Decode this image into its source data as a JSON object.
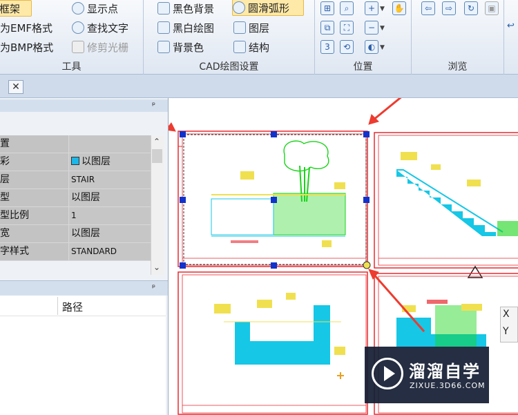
{
  "ribbon": {
    "tools_group": {
      "label": "工具",
      "items": [
        "框架",
        "为EMF格式",
        "为BMP格式",
        "显示点",
        "查找文字",
        "修剪光栅"
      ]
    },
    "cad_settings_group": {
      "label": "CAD绘图设置",
      "items": [
        "黑色背景",
        "黑白绘图",
        "背景色",
        "圆滑弧形",
        "图层",
        "结构"
      ]
    },
    "position_group": {
      "label": "位置"
    },
    "browse_group": {
      "label": "浏览"
    }
  },
  "tab_close_glyph": "✕",
  "properties_panel": {
    "pin_glyph": "ᵖ",
    "rows": [
      {
        "name": "置",
        "value": ""
      },
      {
        "name": "彩",
        "value": "以图层",
        "swatch_color": "#1db7e8"
      },
      {
        "name": "层",
        "value": "STAIR"
      },
      {
        "name": "型",
        "value": "以图层"
      },
      {
        "name": "型比例",
        "value": "1"
      },
      {
        "name": "宽",
        "value": "以图层"
      },
      {
        "name": "字样式",
        "value": "STANDARD"
      }
    ]
  },
  "files_panel": {
    "column_path": "路径"
  },
  "coordinates": {
    "x_label": "X",
    "y_label": "Y"
  },
  "watermark": {
    "title": "溜溜自学",
    "url": "ZIXUE.3D66.COM"
  },
  "colors": {
    "frame_red": "#e8282e",
    "grip_blue": "#1133cc",
    "cad_green": "#19d419",
    "cad_cyan": "#16c7e6",
    "cad_yellow": "#f0e050",
    "arrow_red": "#ee3b2f"
  }
}
